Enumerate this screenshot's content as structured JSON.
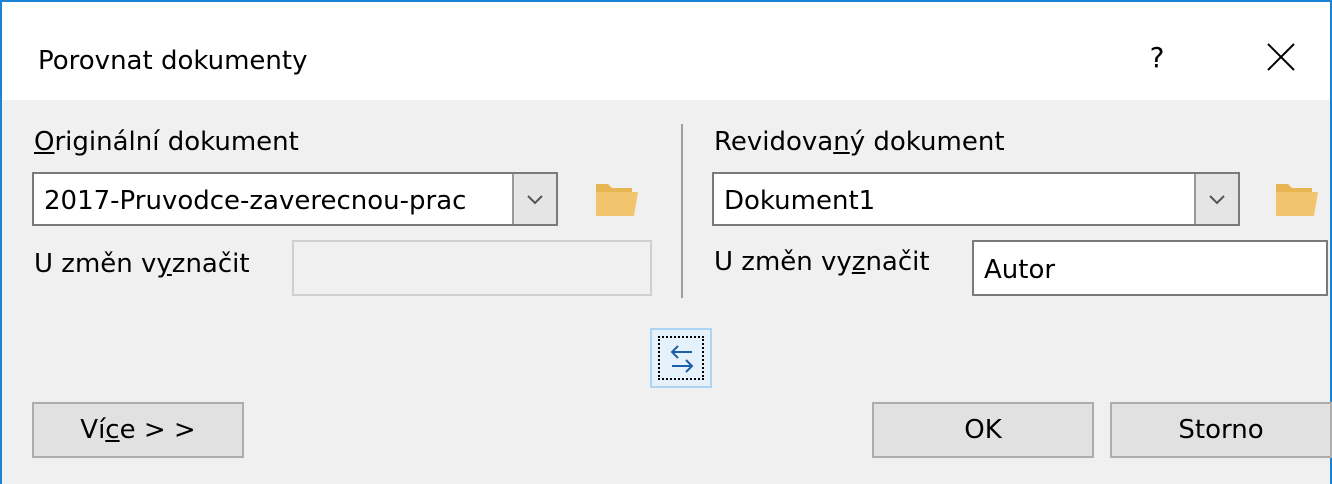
{
  "window": {
    "title": "Porovnat dokumenty",
    "help_label": "?"
  },
  "original": {
    "label_pre": "",
    "label_ul": "O",
    "label_post": "riginální dokument",
    "value": "2017-Pruvodce-zaverecnou-prac",
    "mark_label_pre": "U změn v",
    "mark_label_ul": "y",
    "mark_label_post": "značit",
    "mark_value": ""
  },
  "revised": {
    "label_pre": "Revidova",
    "label_ul": "n",
    "label_post": "ý dokument",
    "value": "Dokument1",
    "mark_label_pre": "U změn vy",
    "mark_label_ul": "z",
    "mark_label_post": "načit",
    "mark_value": "Autor"
  },
  "buttons": {
    "more_pre": "Ví",
    "more_ul": "c",
    "more_post": "e > >",
    "ok": "OK",
    "cancel": "Storno"
  },
  "colors": {
    "accent": "#1883d7",
    "folder": "#f2c46d"
  }
}
